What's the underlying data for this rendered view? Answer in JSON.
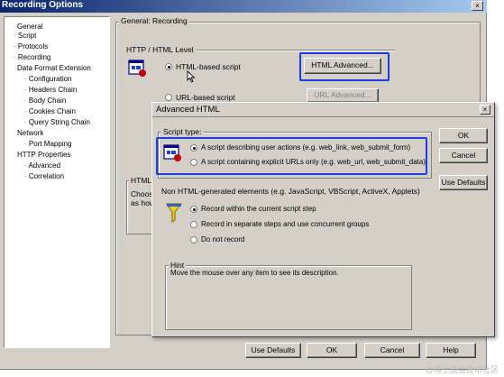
{
  "window": {
    "title": "Recording Options",
    "close_glyph": "×"
  },
  "tree": {
    "items": [
      {
        "label": "General",
        "level": 0
      },
      {
        "label": "Script",
        "level": 1
      },
      {
        "label": "Protocols",
        "level": 1
      },
      {
        "label": "Recording",
        "level": 1
      },
      {
        "label": "Data Format Extension",
        "level": 0
      },
      {
        "label": "Configuration",
        "level": 1
      },
      {
        "label": "Headers Chain",
        "level": 1
      },
      {
        "label": "Body Chain",
        "level": 1
      },
      {
        "label": "Cookies Chain",
        "level": 1
      },
      {
        "label": "Query String Chain",
        "level": 1
      },
      {
        "label": "Network",
        "level": 0
      },
      {
        "label": "Port Mapping",
        "level": 1
      },
      {
        "label": "HTTP Properties",
        "level": 0
      },
      {
        "label": "Advanced",
        "level": 1
      },
      {
        "label": "Correlation",
        "level": 1
      }
    ]
  },
  "main": {
    "section_title": "General: Recording",
    "level_group": "HTTP / HTML Level",
    "html_based": "HTML-based script",
    "html_advanced": "HTML Advanced...",
    "url_based": "URL-based script",
    "url_advanced": "URL Advanced...",
    "desc_group": "HTML",
    "desc_line1": "Choose",
    "desc_line2": "as how"
  },
  "footer": {
    "use_defaults": "Use Defaults",
    "ok": "OK",
    "cancel": "Cancel",
    "help": "Help"
  },
  "dialog": {
    "title": "Advanced HTML",
    "close_glyph": "×",
    "script_type_label": "Script type:",
    "option_user_actions": "A script describing user actions (e.g. web_link, web_submit_form)",
    "option_explicit_urls": "A script containing explicit URLs only (e.g. web_url, web_submit_data)",
    "non_html_label": "Non HTML-generated elements (e.g. JavaScript, VBScript, ActiveX, Applets)",
    "record_within": "Record within the current script step",
    "record_separate": "Record in separate steps and use concurrent groups",
    "do_not_record": "Do not record",
    "hint_label": "Hint",
    "hint_text": "Move the mouse over any item to see its description.",
    "ok": "OK",
    "cancel": "Cancel",
    "use_defaults": "Use Defaults"
  },
  "watermark": "@稀土掘金技术社区",
  "colors": {
    "highlight": "#1a3ee0",
    "titlebar": "#0a246a",
    "face": "#d4d0c8"
  }
}
